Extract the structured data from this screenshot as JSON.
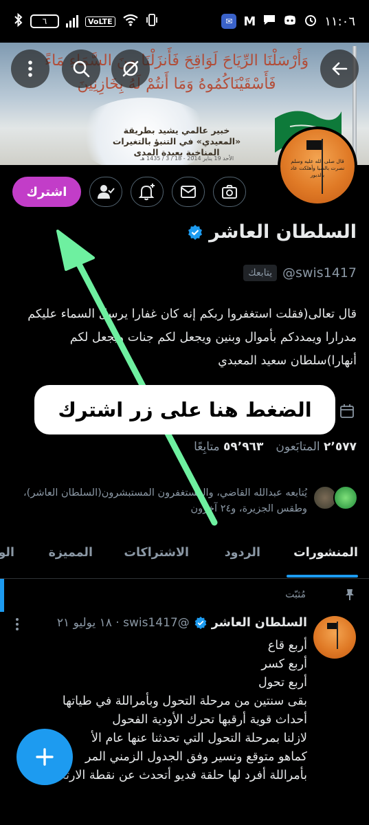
{
  "status_bar": {
    "time": "١١:٠٦",
    "battery": "٦",
    "network_label": "VoLTE"
  },
  "banner": {
    "verse_line1": "وَأَرْسَلْنَا الرِّيَاحَ لَوَاقِحَ فَأَنزَلْنَا مِنَ السَّمَاءِ مَاءً",
    "verse_line2": "فَأَسْقَيْنَاكُمُوهُ وَمَا أَنتُمْ لَهُ بِخَازِنِينَ",
    "subtitle": "خبير عالمي يشيد بطريقة «المعيدي» في التنبؤ بالتغيرات المناخية بعيدة المدى",
    "meta": "الأحد 19 يناير 2014 - 18 / 3 / 1435 هـ"
  },
  "avatar_text": "قال صلى الله عليه وسلم نصرت بالصبا وأهلكت عاد بالدبور",
  "actions": {
    "subscribe_label": "اشترك"
  },
  "profile": {
    "name": "السلطان العاشر",
    "handle": "@swis1417",
    "follows_you": "يتابعك",
    "bio": "قال تعالى(فقلت استغفروا ربكم إنه كان غفارا يرسل السماء عليكم مدرارا ويمددكم بأموال وبنين ويجعل لكم جنات ويجعل لكم أنهارا)سلطان سعيد المعبدي",
    "following_count": "٢٬٥٧٧",
    "following_label": "المتابَعون",
    "followers_count": "٥٩٬٩٦٣",
    "followers_label": "متابِعًا",
    "followed_by": "يُتابعه عبدالله القاضي، والمستغفرون المستبشرون(السلطان العاشر)، وطقس الجزيرة، و٢٤ آخرون"
  },
  "tabs": [
    "المنشورات",
    "الردود",
    "الاشتراكات",
    "المميزة",
    "الو"
  ],
  "tweet": {
    "pinned_label": "مُثبّت",
    "name": "السلطان العاشر",
    "meta": "@swis1417 · ١٨ يوليو ٢١",
    "lines": [
      "أربع قاع",
      "أربع كسر",
      "أربع تحول",
      "بقى سنتين من مرحلة التحول وبأمراللة في طياتها",
      "أحداث قوية أرقبها تحرك الأودية الفحول",
      "لازلنا بمرحلة التحول التي تحدثنا عنها عام الأ",
      "كماهو متوقع ونسير وفق الجدول الزمني المر",
      "بأمراللة أفرد لها حلقة فديو أتحدث عن نقطة الارتكاز"
    ]
  },
  "annotation": {
    "callout_text": "الضغط هنا على زر اشترك",
    "arrow_color": "#6ef0a0"
  },
  "colors": {
    "subscribe": "#c23dc8",
    "accent": "#1d9bf0"
  }
}
